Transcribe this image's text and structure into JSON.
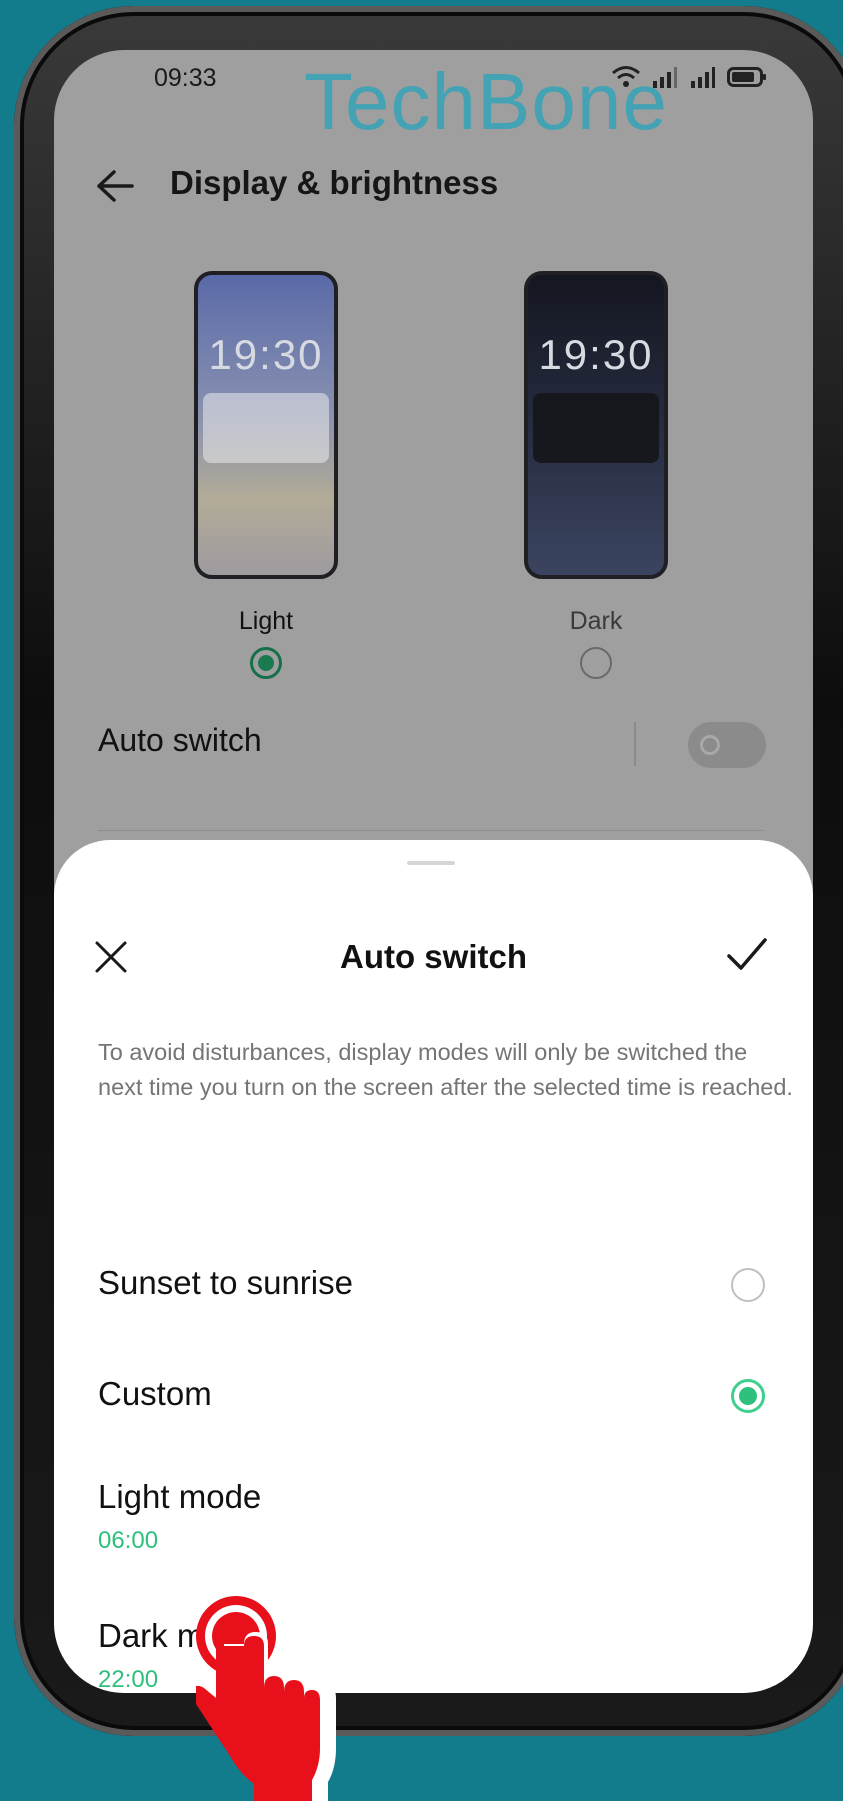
{
  "status_bar": {
    "time": "09:33",
    "icons": [
      "wifi-icon",
      "signal-icon",
      "signal-icon",
      "battery-icon"
    ]
  },
  "watermark": "TechBone",
  "header": {
    "title": "Display & brightness",
    "back_icon": "arrow-left-icon"
  },
  "modes": {
    "light": {
      "label": "Light",
      "preview_time": "19:30",
      "selected": true
    },
    "dark": {
      "label": "Dark",
      "preview_time": "19:30",
      "selected": false
    }
  },
  "auto_switch": {
    "label": "Auto switch",
    "enabled": false
  },
  "sheet": {
    "title": "Auto switch",
    "close_icon": "close-icon",
    "confirm_icon": "check-icon",
    "description": "To avoid disturbances, display modes will only be switched the next time you turn on the screen after the selected time is reached.",
    "options": [
      {
        "label": "Sunset to sunrise",
        "selected": false
      },
      {
        "label": "Custom",
        "selected": true
      }
    ],
    "light_mode": {
      "label": "Light mode",
      "time": "06:00"
    },
    "dark_mode": {
      "label": "Dark mode",
      "time": "22:00"
    }
  },
  "colors": {
    "background": "#137c8c",
    "accent_green": "#2ec07c",
    "watermark": "#3fa3b5",
    "tap_hand": "#e8101a"
  }
}
